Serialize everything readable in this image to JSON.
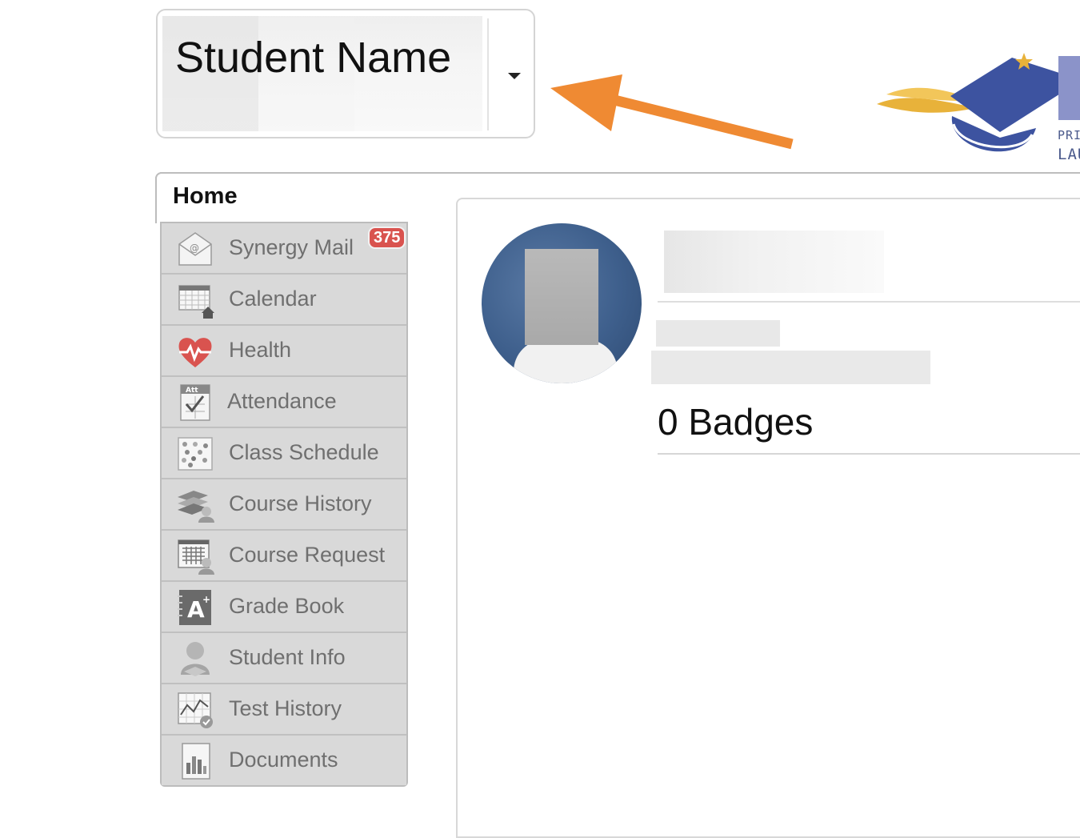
{
  "student_selector": {
    "name": "Student Name"
  },
  "home": {
    "title": "Home"
  },
  "logo": {
    "line1": "PRIN",
    "line2": "LAU"
  },
  "nav": {
    "items": [
      {
        "label": "Synergy Mail",
        "icon": "mail-icon",
        "badge": "375"
      },
      {
        "label": "Calendar",
        "icon": "calendar-icon"
      },
      {
        "label": "Health",
        "icon": "heart-icon"
      },
      {
        "label": "Attendance",
        "icon": "attendance-icon",
        "icon_text": "Att"
      },
      {
        "label": "Class Schedule",
        "icon": "schedule-icon"
      },
      {
        "label": "Course History",
        "icon": "course-history-icon"
      },
      {
        "label": "Course Request",
        "icon": "course-request-icon"
      },
      {
        "label": "Grade Book",
        "icon": "grade-book-icon",
        "icon_text": "A"
      },
      {
        "label": "Student Info",
        "icon": "student-info-icon"
      },
      {
        "label": "Test History",
        "icon": "test-history-icon"
      },
      {
        "label": "Documents",
        "icon": "documents-icon"
      }
    ]
  },
  "profile": {
    "badges": "0 Badges"
  },
  "colors": {
    "arrow": "#ef8a33",
    "badge": "#d9534f",
    "logo_blue": "#3d53a0",
    "logo_gold": "#e8b23a"
  }
}
